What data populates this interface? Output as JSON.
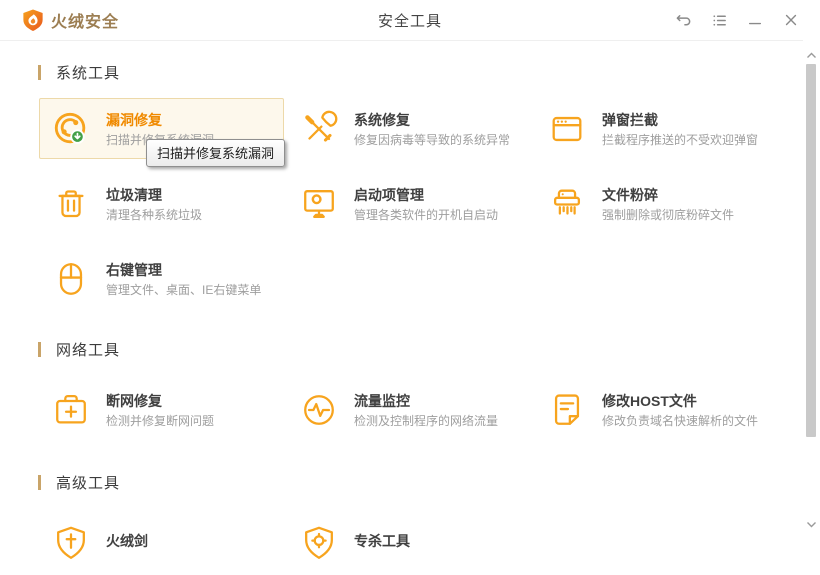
{
  "titlebar": {
    "app_name": "火绒安全",
    "page_title": "安全工具"
  },
  "tooltip": "扫描并修复系统漏洞",
  "colors": {
    "accent_orange": "#F7A41E",
    "hover_card_bg": "#FDF8EC",
    "hover_card_border": "#EDD9A9",
    "hover_title_text": "#F08A00",
    "section_bar": "#C9A469",
    "badge_green": "#43A047",
    "logo_text": "#9C7E52"
  },
  "sections": [
    {
      "title": "系统工具",
      "items": [
        {
          "name": "漏洞修复",
          "desc": "扫描并修复系统漏洞",
          "icon": "vuln-scan",
          "highlighted": true
        },
        {
          "name": "系统修复",
          "desc": "修复因病毒等导致的系统异常",
          "icon": "repair-tools",
          "highlighted": false
        },
        {
          "name": "弹窗拦截",
          "desc": "拦截程序推送的不受欢迎弹窗",
          "icon": "popup-window",
          "highlighted": false
        },
        {
          "name": "垃圾清理",
          "desc": "清理各种系统垃圾",
          "icon": "trash",
          "highlighted": false
        },
        {
          "name": "启动项管理",
          "desc": "管理各类软件的开机自启动",
          "icon": "monitor",
          "highlighted": false
        },
        {
          "name": "文件粉碎",
          "desc": "强制删除或彻底粉碎文件",
          "icon": "shredder",
          "highlighted": false
        },
        {
          "name": "右键管理",
          "desc": "管理文件、桌面、IE右键菜单",
          "icon": "mouse",
          "highlighted": false
        }
      ]
    },
    {
      "title": "网络工具",
      "items": [
        {
          "name": "断网修复",
          "desc": "检测并修复断网问题",
          "icon": "medkit",
          "highlighted": false
        },
        {
          "name": "流量监控",
          "desc": "检测及控制程序的网络流量",
          "icon": "pulse",
          "highlighted": false
        },
        {
          "name": "修改HOST文件",
          "desc": "修改负责域名快速解析的文件",
          "icon": "host-file",
          "highlighted": false
        }
      ]
    },
    {
      "title": "高级工具",
      "items": [
        {
          "name": "火绒剑",
          "desc": "",
          "icon": "shield-sword",
          "highlighted": false
        },
        {
          "name": "专杀工具",
          "desc": "",
          "icon": "shield-kill",
          "highlighted": false
        }
      ]
    }
  ]
}
